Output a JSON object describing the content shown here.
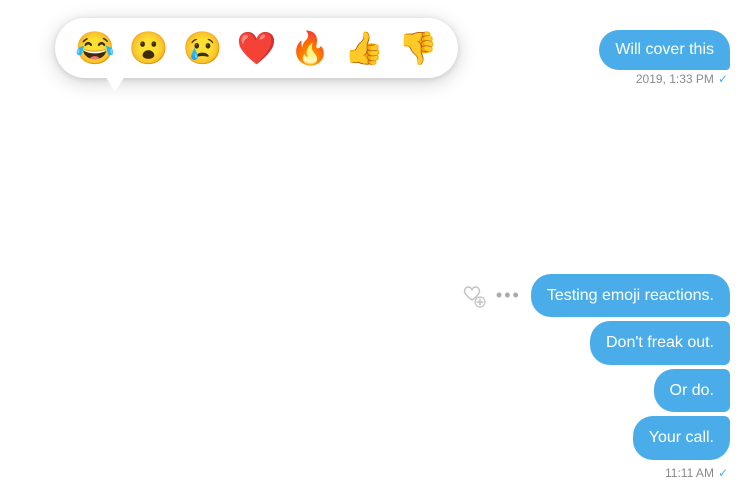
{
  "reactionPopup": {
    "emojis": [
      {
        "id": "laugh-cry",
        "char": "😂"
      },
      {
        "id": "surprised",
        "char": "😮"
      },
      {
        "id": "cry",
        "char": "😢"
      },
      {
        "id": "heart",
        "char": "❤️"
      },
      {
        "id": "fire",
        "char": "🔥"
      },
      {
        "id": "thumbs-up",
        "char": "👍"
      },
      {
        "id": "thumbs-down",
        "char": "👎"
      }
    ]
  },
  "messages": [
    {
      "id": "msg-top",
      "text": "Will cover this",
      "timestamp": "2019, 1:33 PM",
      "type": "sent",
      "partial": true
    },
    {
      "id": "msg-1",
      "text": "Testing emoji reactions.",
      "type": "sent"
    },
    {
      "id": "msg-2",
      "text": "Don't freak out.",
      "type": "sent"
    },
    {
      "id": "msg-3",
      "text": "Or do.",
      "type": "sent"
    },
    {
      "id": "msg-4",
      "text": "Your call.",
      "type": "sent"
    }
  ],
  "bottomTimestamp": "11:11 AM",
  "actions": {
    "moreLabel": "•••"
  }
}
